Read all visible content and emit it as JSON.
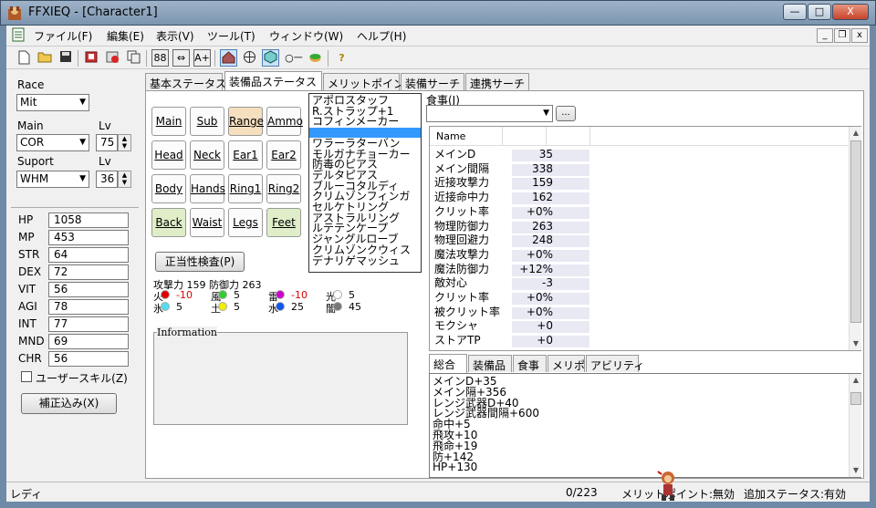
{
  "window": {
    "title": "FFXIEQ - [Character1]",
    "minimize": "—",
    "maximize": "□",
    "close": "X"
  },
  "menu": [
    "ファイル(F)",
    "編集(E)",
    "表示(V)",
    "ツール(T)",
    "ウィンドウ(W)",
    "ヘルプ(H)"
  ],
  "mdi": {
    "minimize": "_",
    "restore": "❐",
    "close": "x"
  },
  "toolbar": {
    "icons": [
      "new-file-icon",
      "open-folder-icon",
      "save-icon",
      "book-icon",
      "delete-set-icon",
      "copy-icon",
      "dial-icon",
      "fight-icon",
      "text-icon",
      "home-icon",
      "globe-icon",
      "cube-icon",
      "key-icon",
      "food-icon",
      "help-icon"
    ],
    "labels": {
      "dial": "88",
      "fight": "⇔",
      "text": "A+",
      "key": "○ㅡ",
      "help": "?"
    }
  },
  "left": {
    "race_label": "Race",
    "race_value": "Mit",
    "main_label": "Main",
    "main_value": "COR",
    "main_lv_label": "Lv",
    "main_lv": "75",
    "support_label": "Suport",
    "support_value": "WHM",
    "support_lv_label": "Lv",
    "support_lv": "36",
    "stats": [
      {
        "name": "HP",
        "value": "1058"
      },
      {
        "name": "MP",
        "value": "453"
      },
      {
        "name": "STR",
        "value": "64"
      },
      {
        "name": "DEX",
        "value": "72"
      },
      {
        "name": "VIT",
        "value": "56"
      },
      {
        "name": "AGI",
        "value": "78"
      },
      {
        "name": "INT",
        "value": "77"
      },
      {
        "name": "MND",
        "value": "69"
      },
      {
        "name": "CHR",
        "value": "56"
      }
    ],
    "user_skill_label": "ユーザースキル(Z)",
    "correction_button": "補正込み(X)"
  },
  "tabs": [
    "基本ステータス",
    "装備品ステータス",
    "メリットポイント",
    "装備サーチ",
    "連携サーチ"
  ],
  "slots": [
    {
      "label": "Main"
    },
    {
      "label": "Sub"
    },
    {
      "label": "Range"
    },
    {
      "label": "Ammo"
    },
    {
      "label": "Head"
    },
    {
      "label": "Neck"
    },
    {
      "label": "Ear1"
    },
    {
      "label": "Ear2"
    },
    {
      "label": "Body"
    },
    {
      "label": "Hands"
    },
    {
      "label": "Ring1"
    },
    {
      "label": "Ring2"
    },
    {
      "label": "Back"
    },
    {
      "label": "Waist"
    },
    {
      "label": "Legs"
    },
    {
      "label": "Feet"
    }
  ],
  "validity_button": "正当性検査(P)",
  "atk_def": "攻撃力 159 防御力 263",
  "elements": [
    {
      "name": "火",
      "value": "-10",
      "color": "#dd0000",
      "valcolor": "#dd0000"
    },
    {
      "name": "風",
      "value": "5",
      "color": "#33cc33",
      "valcolor": "#000000"
    },
    {
      "name": "雷",
      "value": "-10",
      "color": "#cc00cc",
      "valcolor": "#dd0000"
    },
    {
      "name": "光",
      "value": "5",
      "color": "#ffffff",
      "valcolor": "#000000"
    },
    {
      "name": "氷",
      "value": "5",
      "color": "#55ddee",
      "valcolor": "#000000"
    },
    {
      "name": "土",
      "value": "5",
      "color": "#eeee00",
      "valcolor": "#000000"
    },
    {
      "name": "水",
      "value": "25",
      "color": "#1155ee",
      "valcolor": "#000000"
    },
    {
      "name": "闇",
      "value": "45",
      "color": "#777777",
      "valcolor": "#000000"
    }
  ],
  "information_label": "Information",
  "items": [
    "アポロスタッフ",
    "R.ストラップ+1",
    "コフィンメーカー",
    "",
    "ワラーラターバン",
    "モルガナチョーカー",
    "防毒のピアス",
    "デルタピアス",
    "ブルーコタルディ",
    "クリムゾンフィンガ",
    "セルケトリング",
    "アストラルリング",
    "ルテテンケープ",
    "ジャングルローブ",
    "クリムゾンクウィス",
    "デナリゲマッシュ"
  ],
  "food": {
    "label": "食事(J)",
    "value": "",
    "button": "..."
  },
  "stat_table": {
    "header": "Name",
    "rows": [
      {
        "name": "メインD",
        "value": "35"
      },
      {
        "name": "メイン間隔",
        "value": "338"
      },
      {
        "name": "近接攻撃力",
        "value": "159"
      },
      {
        "name": "近接命中力",
        "value": "162"
      },
      {
        "name": "クリット率",
        "value": "+0%"
      },
      {
        "name": "物理防御力",
        "value": "263"
      },
      {
        "name": "物理回避力",
        "value": "248"
      },
      {
        "name": "魔法攻撃力",
        "value": "+0%"
      },
      {
        "name": "魔法防御力",
        "value": "+12%"
      },
      {
        "name": "敵対心",
        "value": "-3"
      },
      {
        "name": "クリット率",
        "value": "+0%"
      },
      {
        "name": "被クリット率",
        "value": "+0%"
      },
      {
        "name": "モクシャ",
        "value": "+0"
      },
      {
        "name": "ストアTP",
        "value": "+0"
      }
    ]
  },
  "bottom_tabs": [
    "総合",
    "装備品",
    "食事",
    "メリポ",
    "アビリティ"
  ],
  "totals": [
    "メインD+35",
    "メイン隔+356",
    "レンジ武器D+40",
    "レンジ武器間隔+600",
    "命中+5",
    "飛攻+10",
    "飛命+19",
    "防+142",
    "HP+130"
  ],
  "status": {
    "left": "レディ",
    "count": "0/223",
    "merit": "メリットポイント:無効",
    "extra": "追加ステータス:有効"
  }
}
